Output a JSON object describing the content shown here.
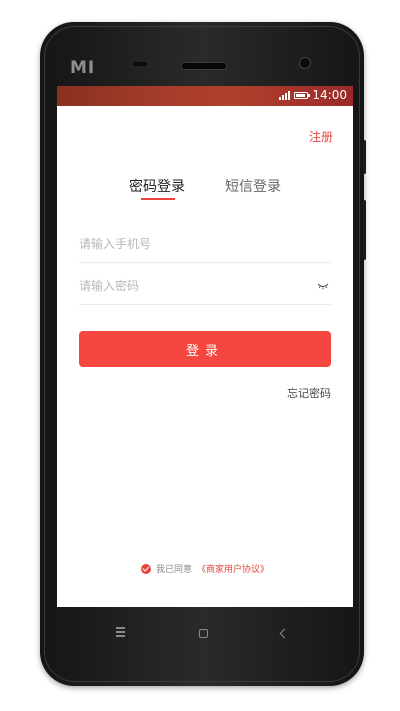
{
  "device": {
    "brand_logo": "MI"
  },
  "status_bar": {
    "time": "14:00",
    "signal_icon": "signal-icon",
    "battery_icon": "battery-icon",
    "gradient_colors": [
      "#8a3022",
      "#b0402c",
      "#9a2a2a"
    ]
  },
  "header": {
    "register_label": "注册"
  },
  "tabs": [
    {
      "label": "密码登录",
      "active": true
    },
    {
      "label": "短信登录",
      "active": false
    }
  ],
  "form": {
    "phone_placeholder": "请输入手机号",
    "password_placeholder": "请输入密码",
    "eye_icon": "eye-closed-icon",
    "login_label": "登录",
    "forgot_label": "忘记密码"
  },
  "agreement": {
    "checked": true,
    "text": "我已同意",
    "link": "《商家用户协议》"
  },
  "nav": {
    "menu_icon": "menu-icon",
    "home_icon": "home-icon",
    "back_icon": "back-icon"
  },
  "colors": {
    "accent": "#e8453c",
    "button": "#f5463f",
    "phone_body": "#1f1f1f"
  }
}
